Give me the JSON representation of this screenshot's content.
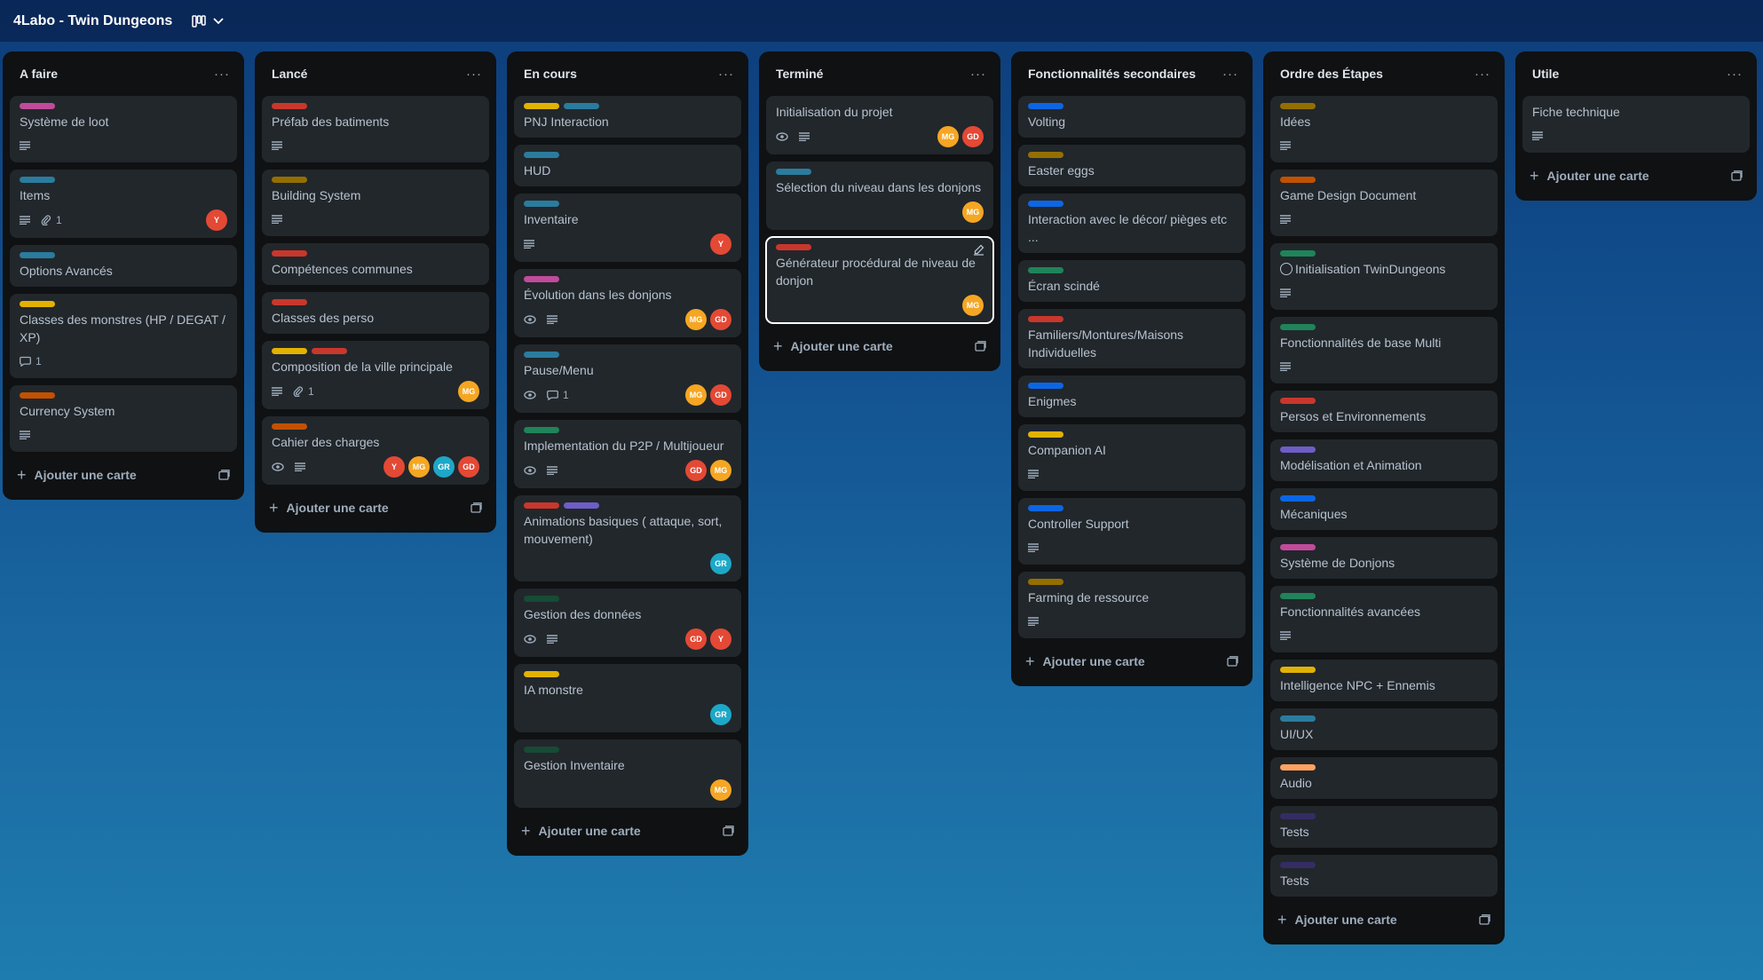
{
  "board": {
    "title": "4Labo - Twin Dungeons"
  },
  "add_card_label": "Ajouter une carte",
  "avatar_colors": {
    "Y": "#e34935",
    "MG": "#f5a623",
    "GD": "#e34935",
    "GR": "#1da8c7"
  },
  "lists": [
    {
      "title": "A faire",
      "cards": [
        {
          "labels": [
            "#c04b9b"
          ],
          "title": "Système de loot",
          "desc": true
        },
        {
          "labels": [
            "#2a7c9e"
          ],
          "title": "Items",
          "desc": true,
          "attachments": "1",
          "members": [
            "Y"
          ]
        },
        {
          "labels": [
            "#2a7c9e"
          ],
          "title": "Options Avancés"
        },
        {
          "labels": [
            "#e2b203"
          ],
          "title": "Classes des monstres (HP / DEGAT / XP)",
          "comments": "1"
        },
        {
          "labels": [
            "#c25100"
          ],
          "title": "Currency System",
          "desc": true
        }
      ]
    },
    {
      "title": "Lancé",
      "cards": [
        {
          "labels": [
            "#c9372c"
          ],
          "title": "Préfab des batiments",
          "desc": true
        },
        {
          "labels": [
            "#946f00"
          ],
          "title": "Building System",
          "desc": true
        },
        {
          "labels": [
            "#c9372c"
          ],
          "title": "Compétences communes"
        },
        {
          "labels": [
            "#c9372c"
          ],
          "title": "Classes des perso"
        },
        {
          "labels": [
            "#e2b203",
            "#c9372c"
          ],
          "title": "Composition de la ville principale",
          "desc": true,
          "attachments": "1",
          "members": [
            "MG"
          ]
        },
        {
          "labels": [
            "#c25100"
          ],
          "title": "Cahier des charges",
          "watch": true,
          "desc": true,
          "members": [
            "Y",
            "MG",
            "GR",
            "GD"
          ]
        }
      ]
    },
    {
      "title": "En cours",
      "cards": [
        {
          "labels": [
            "#e2b203",
            "#2a7c9e"
          ],
          "title": "PNJ Interaction"
        },
        {
          "labels": [
            "#2a7c9e"
          ],
          "title": "HUD"
        },
        {
          "labels": [
            "#2a7c9e"
          ],
          "title": "Inventaire",
          "desc": true,
          "members": [
            "Y"
          ]
        },
        {
          "labels": [
            "#c04b9b"
          ],
          "title": "Évolution dans les donjons",
          "watch": true,
          "desc": true,
          "members": [
            "MG",
            "GD"
          ]
        },
        {
          "labels": [
            "#2a7c9e"
          ],
          "title": "Pause/Menu",
          "watch": true,
          "comments": "1",
          "members": [
            "MG",
            "GD"
          ]
        },
        {
          "labels": [
            "#1f845a"
          ],
          "title": "Implementation du P2P / Multijoueur",
          "watch": true,
          "desc": true,
          "members": [
            "GD",
            "MG"
          ]
        },
        {
          "labels": [
            "#c9372c",
            "#6e5dc6"
          ],
          "title": "Animations basiques ( attaque, sort, mouvement)",
          "members": [
            "GR"
          ]
        },
        {
          "labels": [
            "#164b35"
          ],
          "title": "Gestion des données",
          "watch": true,
          "desc": true,
          "members": [
            "GD",
            "Y"
          ]
        },
        {
          "labels": [
            "#e2b203"
          ],
          "title": "IA monstre",
          "members": [
            "GR"
          ]
        },
        {
          "labels": [
            "#164b35"
          ],
          "title": "Gestion Inventaire",
          "members": [
            "MG"
          ]
        }
      ]
    },
    {
      "title": "Terminé",
      "cards": [
        {
          "title": "Initialisation du projet",
          "watch": true,
          "desc": true,
          "members": [
            "MG",
            "GD"
          ]
        },
        {
          "labels": [
            "#2a7c9e"
          ],
          "title": "Sélection du niveau dans les donjons",
          "members": [
            "MG"
          ]
        },
        {
          "labels": [
            "#c9372c"
          ],
          "title": "Générateur procédural de niveau de donjon",
          "members": [
            "MG"
          ],
          "selected": true
        }
      ]
    },
    {
      "title": "Fonctionnalités secondaires",
      "cards": [
        {
          "labels": [
            "#0c66e4"
          ],
          "title": "Volting"
        },
        {
          "labels": [
            "#946f00"
          ],
          "title": "Easter eggs"
        },
        {
          "labels": [
            "#0c66e4"
          ],
          "title": "Interaction avec le décor/ pièges etc ..."
        },
        {
          "labels": [
            "#1f845a"
          ],
          "title": "Écran scindé"
        },
        {
          "labels": [
            "#c9372c"
          ],
          "title": "Familiers/Montures/Maisons Individuelles"
        },
        {
          "labels": [
            "#0c66e4"
          ],
          "title": "Enigmes"
        },
        {
          "labels": [
            "#e2b203"
          ],
          "title": "Companion AI",
          "desc": true
        },
        {
          "labels": [
            "#0c66e4"
          ],
          "title": "Controller Support",
          "desc": true
        },
        {
          "labels": [
            "#946f00"
          ],
          "title": "Farming de ressource",
          "desc": true
        }
      ]
    },
    {
      "title": "Ordre des Étapes",
      "cards": [
        {
          "labels": [
            "#946f00"
          ],
          "title": "Idées",
          "desc": true
        },
        {
          "labels": [
            "#c25100"
          ],
          "title": "Game Design Document",
          "desc": true
        },
        {
          "labels": [
            "#1f845a"
          ],
          "title": "Initialisation TwinDungeons",
          "desc": true,
          "circle": true
        },
        {
          "labels": [
            "#1f845a"
          ],
          "title": "Fonctionnalités de base Multi",
          "desc": true
        },
        {
          "labels": [
            "#c9372c"
          ],
          "title": "Persos et Environnements"
        },
        {
          "labels": [
            "#6e5dc6"
          ],
          "title": "Modélisation et Animation"
        },
        {
          "labels": [
            "#0c66e4"
          ],
          "title": "Mécaniques"
        },
        {
          "labels": [
            "#c04b9b"
          ],
          "title": "Système de Donjons"
        },
        {
          "labels": [
            "#1f845a"
          ],
          "title": "Fonctionnalités avancées",
          "desc": true
        },
        {
          "labels": [
            "#e2b203"
          ],
          "title": "Intelligence NPC + Ennemis"
        },
        {
          "labels": [
            "#2a7c9e"
          ],
          "title": "UI/UX"
        },
        {
          "labels": [
            "#fea362"
          ],
          "title": "Audio"
        },
        {
          "labels": [
            "#352c63"
          ],
          "title": "Tests"
        },
        {
          "labels": [
            "#352c63"
          ],
          "title": "Tests"
        }
      ]
    },
    {
      "title": "Utile",
      "cards": [
        {
          "title": "Fiche technique",
          "desc": true
        }
      ]
    }
  ]
}
